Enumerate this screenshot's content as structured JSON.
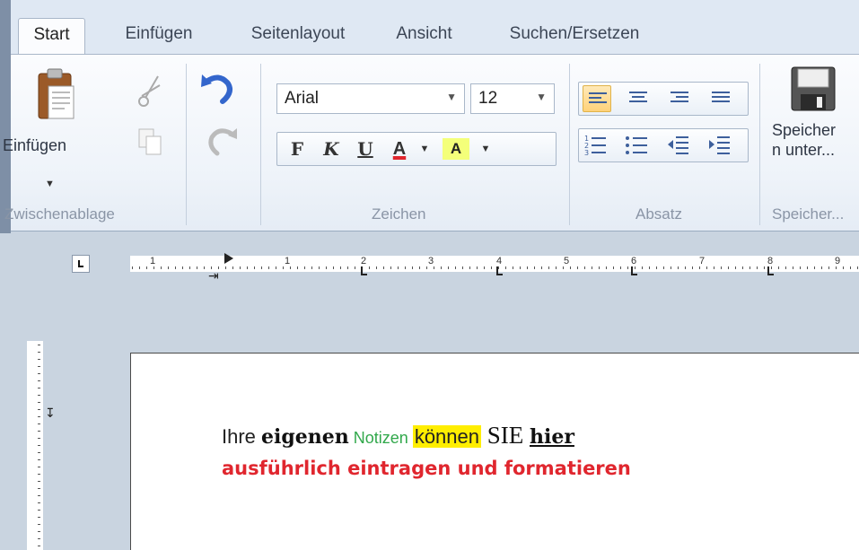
{
  "tabs": [
    {
      "label": "Start",
      "active": true
    },
    {
      "label": "Einfügen",
      "active": false
    },
    {
      "label": "Seitenlayout",
      "active": false
    },
    {
      "label": "Ansicht",
      "active": false
    },
    {
      "label": "Suchen/Ersetzen",
      "active": false
    }
  ],
  "clipboard": {
    "paste_label": "Einfügen",
    "group_label": "Zwischenablage"
  },
  "font": {
    "family": "Arial",
    "size": "12",
    "bold_label": "F",
    "italic_label": "K",
    "underline_label": "U",
    "color_label": "A",
    "highlight_label": "A",
    "group_label": "Zeichen"
  },
  "paragraph": {
    "group_label": "Absatz",
    "active_alignment": "left"
  },
  "save": {
    "button_label": "Speicher\nn unter...",
    "group_label": "Speicher..."
  },
  "ruler": {
    "numbers": [
      "1",
      "1",
      "2",
      "3",
      "4",
      "5",
      "6",
      "7",
      "8",
      "9"
    ]
  },
  "document": {
    "line1": {
      "w1": "Ihre ",
      "w2": "eigenen",
      "w3": " Notizen ",
      "w4": "können",
      "w5": " SIE ",
      "w6": "hier"
    },
    "line2": "ausführlich eintragen und formatieren"
  },
  "colors": {
    "accent_red": "#e0262e",
    "notizen_green": "#31a84b",
    "highlight_yellow": "#ffee00",
    "ribbon_bg": "#f3f6fb",
    "canvas_bg": "#c9d4e0"
  }
}
